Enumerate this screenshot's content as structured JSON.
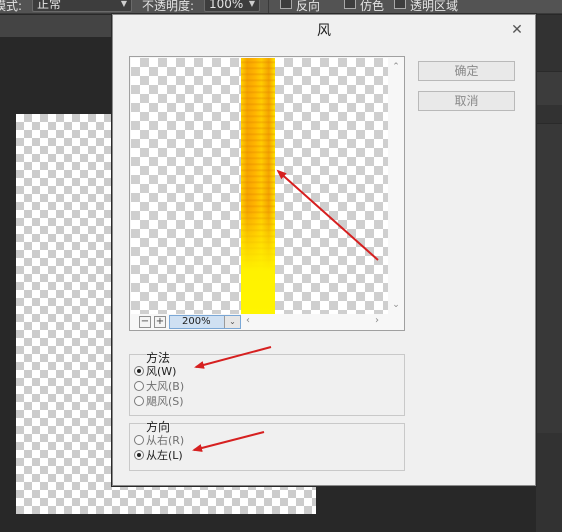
{
  "options_bar": {
    "mode_label": "模式:",
    "mode_value": "正常",
    "opacity_label": "不透明度:",
    "opacity_value": "100%",
    "reverse_label": "反向",
    "dither_label": "仿色",
    "transparency_label": "透明区域"
  },
  "dialog": {
    "title": "风",
    "ok_label": "确定",
    "cancel_label": "取消",
    "zoom_value": "200%",
    "method": {
      "legend": "方法",
      "options": [
        {
          "label": "风(W)",
          "selected": true
        },
        {
          "label": "大风(B)",
          "selected": false
        },
        {
          "label": "飓风(S)",
          "selected": false
        }
      ]
    },
    "direction": {
      "legend": "方向",
      "options": [
        {
          "label": "从右(R)",
          "selected": false
        },
        {
          "label": "从左(L)",
          "selected": true
        }
      ]
    }
  },
  "colors": {
    "annotation_arrow": "#d62020",
    "fire_yellow": "#ffcc00",
    "dialog_bg": "#f0f0f0"
  }
}
